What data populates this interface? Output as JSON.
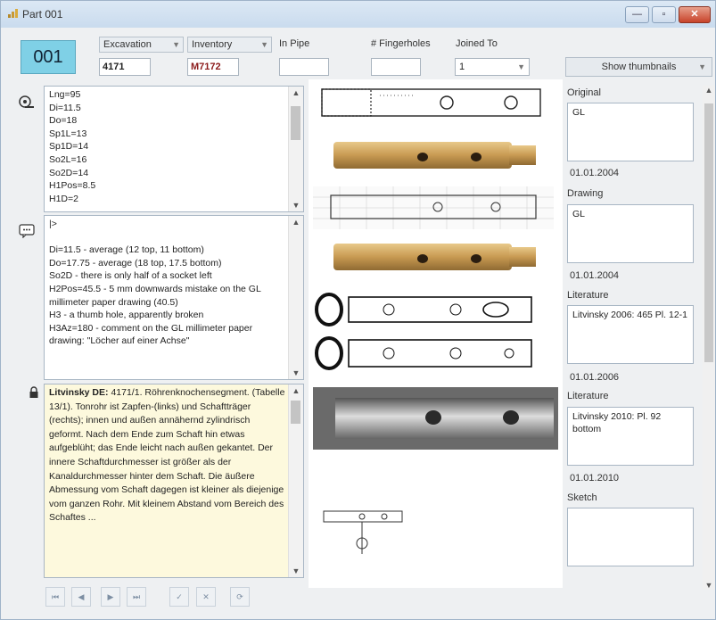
{
  "window": {
    "title": "Part 001",
    "btn_min": "—",
    "btn_max": "▫",
    "btn_close": "✕"
  },
  "header": {
    "id_value": "001",
    "excavation_label": "Excavation",
    "excavation_value": "4171",
    "inventory_label": "Inventory",
    "inventory_value": "M7172",
    "in_pipe_label": "In Pipe",
    "in_pipe_value": "",
    "fingerholes_label": "# Fingerholes",
    "fingerholes_value": "",
    "joined_to_label": "Joined To",
    "joined_to_value": "1",
    "show_thumbnails_label": "Show thumbnails"
  },
  "measurements": {
    "lines": "Lng=95\nDi=11.5\nDo=18\nSp1L=13\nSp1D=14\nSo2L=16\nSo2D=14\nH1Pos=8.5\nH1D=2"
  },
  "comments": {
    "lines": "|>\n\nDi=11.5 - average (12 top, 11 bottom)\nDo=17.75 - average (18 top, 17.5 bottom)\nSo2D - there is only half of a socket left\nH2Pos=45.5 - 5 mm downwards mistake on the GL millimeter paper drawing (40.5)\nH3 - a thumb hole, apparently broken\nH3Az=180 - comment on the GL millimeter paper drawing: \"Löcher auf einer Achse\""
  },
  "literature_note": {
    "bold": "Litvinsky DE:",
    "text": " 4171/1. Röhrenknochensegment. (Tabelle 13/1). Tonrohr ist Zapfen-(links) und Schaftträger (rechts); innen und außen annähernd zylindrisch geformt. Nach dem Ende zum Schaft hin etwas aufgeblüht; das Ende leicht nach außen gekantet. Der innere Schaftdurchmesser ist größer als der Kanaldurchmesser hinter dem Schaft. Die äußere Abmessung vom Schaft dagegen ist kleiner als diejenige vom ganzen Rohr. Mit kleinem Abstand vom Bereich des Schaftes ..."
  },
  "sources": [
    {
      "caption": "Original",
      "text": "GL",
      "date": "01.01.2004"
    },
    {
      "caption": "Drawing",
      "text": "GL",
      "date": "01.01.2004"
    },
    {
      "caption": "Literature",
      "text": "Litvinsky 2006: 465 Pl. 12-1",
      "date": "01.01.2006"
    },
    {
      "caption": "Literature",
      "text": "Litvinsky 2010: Pl. 92 bottom",
      "date": "01.01.2010"
    },
    {
      "caption": "Sketch",
      "text": "",
      "date": ""
    }
  ],
  "nav": {
    "first": "⏮",
    "prev": "◀",
    "next": "▶",
    "last": "⏭",
    "save": "✓",
    "cancel": "✕",
    "refresh": "⟳"
  },
  "colors": {
    "id_bg": "#7fd0e6",
    "note_bg": "#fdf9dd",
    "inventory_text": "#8b1a1a"
  }
}
